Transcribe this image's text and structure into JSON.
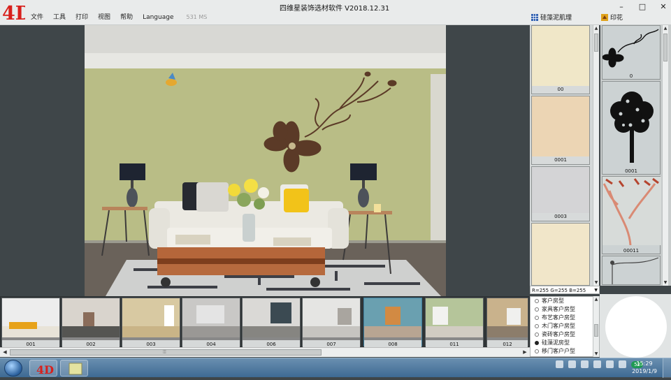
{
  "window": {
    "title": "四维星装饰选材软件 V2018.12.31",
    "logo_text": "4D"
  },
  "menu": [
    {
      "label": "文件"
    },
    {
      "label": "工具"
    },
    {
      "label": "打印"
    },
    {
      "label": "视图"
    },
    {
      "label": "帮助"
    },
    {
      "label": "Language"
    }
  ],
  "timing": "531 MS",
  "panels": {
    "texture_tab": "硅藻泥肌理",
    "print_tab": "印花"
  },
  "textures": [
    {
      "label": "00",
      "color": "#f0e7c8"
    },
    {
      "label": "0001",
      "color": "#ecd5b4"
    },
    {
      "label": "0003",
      "color": "#d4d4d6"
    },
    {
      "label": "",
      "color": "#f1e6c9"
    }
  ],
  "prints": [
    {
      "label": "0",
      "icon": "flower-vine-icon"
    },
    {
      "label": "0001",
      "icon": "tree-icon"
    },
    {
      "label": "00011",
      "icon": "branch-icon"
    },
    {
      "label": "",
      "icon": "vine-icon"
    }
  ],
  "rgb_readout": "R=255  G=255  B=255",
  "room_types": [
    {
      "label": "客户房型",
      "selected": false
    },
    {
      "label": "家具客户房型",
      "selected": false
    },
    {
      "label": "布艺客户房型",
      "selected": false
    },
    {
      "label": "木门客户房型",
      "selected": false
    },
    {
      "label": "瓷砖客户房型",
      "selected": false
    },
    {
      "label": "硅藻泥房型",
      "selected": true
    },
    {
      "label": "移门客户户型",
      "selected": false
    }
  ],
  "rooms": [
    {
      "label": "001",
      "wall": "#ededed",
      "floor": "#e8e3d8",
      "accent": "#e7a21a"
    },
    {
      "label": "002",
      "wall": "#d9d4cd",
      "floor": "#555552",
      "accent": "#8a6c5a"
    },
    {
      "label": "003",
      "wall": "#d8c9a2",
      "floor": "#c9b487",
      "accent": "#ffffff"
    },
    {
      "label": "004",
      "wall": "#c9c8c6",
      "floor": "#9a9895",
      "accent": "#e4e4e4"
    },
    {
      "label": "006",
      "wall": "#dad9d6",
      "floor": "#868581",
      "accent": "#3b4a52"
    },
    {
      "label": "007",
      "wall": "#e5e5e3",
      "floor": "#c6c4c0",
      "accent": "#a9a59f"
    },
    {
      "label": "008",
      "wall": "#6aa0b0",
      "floor": "#b8a592",
      "accent": "#d28a43"
    },
    {
      "label": "011",
      "wall": "#b5c59a",
      "floor": "#d1ccc2",
      "accent": "#f2f2f0"
    },
    {
      "label": "012",
      "wall": "#c9b28c",
      "floor": "#8c7d6b",
      "accent": "#f0f0ee"
    }
  ],
  "taskbar": {
    "badge": "52",
    "time": "15:29",
    "date": "2019/1/9"
  }
}
